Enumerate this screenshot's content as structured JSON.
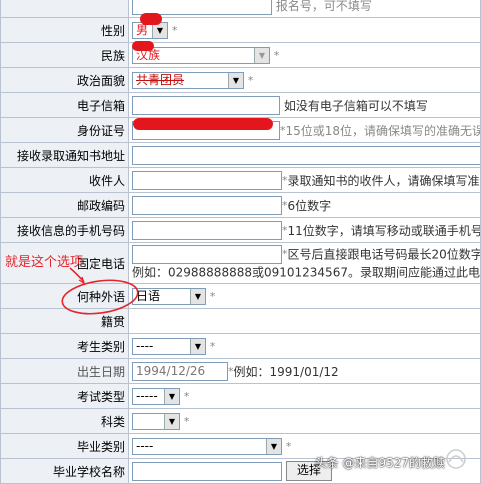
{
  "rows": [
    {
      "label": "",
      "value": "",
      "hint": "报名号，可不填写"
    },
    {
      "label": "性别",
      "value": "男"
    },
    {
      "label": "民族",
      "value": "汉族"
    },
    {
      "label": "政治面貌",
      "value": "共青团员"
    },
    {
      "label": "电子信箱",
      "hint": "如没有电子信箱可以不填写"
    },
    {
      "label": "身份证号",
      "hint": "15位或18位，请确保填写的准确无误"
    },
    {
      "label": "接收录取通知书地址"
    },
    {
      "label": "收件人",
      "hint": "录取通知书的收件人，请确保填写准"
    },
    {
      "label": "邮政编码",
      "hint": "6位数字"
    },
    {
      "label": "接收信息的手机号码",
      "hint": "11位数字，请填写移动或联通手机号"
    },
    {
      "label": "固定电话",
      "hint": "区号后直接跟电话号码最长20位数字",
      "example": "例如：02988888888或09101234567。录取期间应能通过此电"
    },
    {
      "label": "何种外语",
      "value": "日语"
    },
    {
      "label": "籍贯"
    },
    {
      "label": "考生类别",
      "value": "----"
    },
    {
      "label": "出生日期",
      "value": "1994/12/26",
      "hint": "例如：1991/01/12"
    },
    {
      "label": "考试类型",
      "value": "-----"
    },
    {
      "label": "科类",
      "value": ""
    },
    {
      "label": "毕业类别",
      "value": "----"
    },
    {
      "label": "毕业学校名称",
      "button": "选择"
    }
  ],
  "annotation": {
    "text": "就是这个选项"
  },
  "watermark": {
    "text": "头条 @来自9527的救赎",
    "logo_text": "凤凰网"
  },
  "colors": {
    "label_bg": "#edf1f6",
    "border": "#b8c2d0",
    "annotation": "#e6242a"
  }
}
